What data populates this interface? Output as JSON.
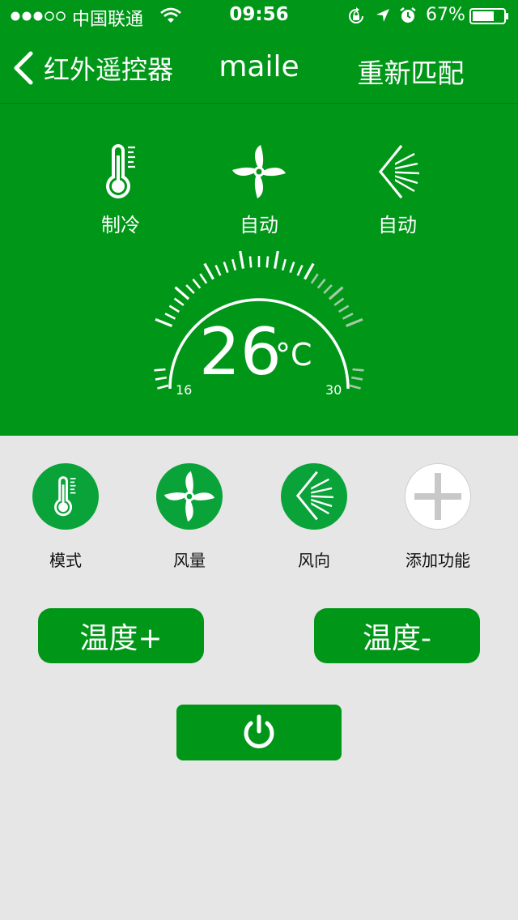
{
  "status_bar": {
    "carrier": "中国联通",
    "time": "09:56",
    "battery": "67%"
  },
  "nav": {
    "back_label": "红外遥控器",
    "device_name": "maile",
    "rematch_label": "重新匹配"
  },
  "modes": [
    {
      "icon": "thermometer-icon",
      "label": "制冷"
    },
    {
      "icon": "fan-icon",
      "label": "自动"
    },
    {
      "icon": "wind-direction-icon",
      "label": "自动"
    }
  ],
  "dial": {
    "temperature": "26",
    "unit": "°C",
    "min_label": "16",
    "max_label": "30",
    "min": 16,
    "max": 30,
    "value": 26
  },
  "functions": [
    {
      "icon": "thermometer-icon",
      "label": "模式"
    },
    {
      "icon": "fan-icon",
      "label": "风量"
    },
    {
      "icon": "wind-direction-icon",
      "label": "风向"
    },
    {
      "icon": "plus-icon",
      "label": "添加功能"
    }
  ],
  "controls": {
    "temp_up_label": "温度+",
    "temp_down_label": "温度-"
  },
  "colors": {
    "primary_green": "#009718",
    "circle_green": "#0aa33a",
    "background": "#e6e6e6"
  }
}
